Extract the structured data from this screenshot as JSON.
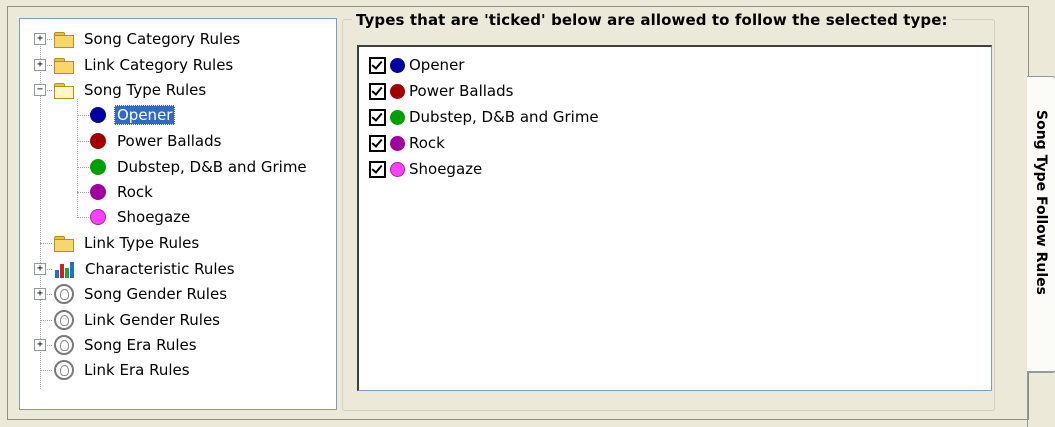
{
  "tree": {
    "items": [
      {
        "label": "Song Category Rules",
        "icon": "folder-icon"
      },
      {
        "label": "Link Category Rules",
        "icon": "folder-icon"
      },
      {
        "label": "Song Type Rules",
        "icon": "open-folder-icon"
      },
      {
        "label": "Opener",
        "icon": "dot",
        "color": "#0000a0",
        "selected": true
      },
      {
        "label": "Power Ballads",
        "icon": "dot",
        "color": "#a00000"
      },
      {
        "label": "Dubstep, D&B and Grime",
        "icon": "dot",
        "color": "#00a000"
      },
      {
        "label": "Rock",
        "icon": "dot",
        "color": "#a000a0"
      },
      {
        "label": "Shoegaze",
        "icon": "dot",
        "color": "#ff40ff"
      },
      {
        "label": "Link Type Rules",
        "icon": "folder-icon"
      },
      {
        "label": "Characteristic Rules",
        "icon": "chart-icon"
      },
      {
        "label": "Song Gender Rules",
        "icon": "gender-icon"
      },
      {
        "label": "Link Gender Rules",
        "icon": "gender-icon"
      },
      {
        "label": "Song Era Rules",
        "icon": "gender-icon"
      },
      {
        "label": "Link Era Rules",
        "icon": "gender-icon"
      }
    ]
  },
  "group": {
    "title": "Types that are 'ticked' below are allowed to follow the selected type:"
  },
  "checklist": [
    {
      "label": "Opener",
      "checked": true,
      "color": "#0000a0"
    },
    {
      "label": "Power Ballads",
      "checked": true,
      "color": "#a00000"
    },
    {
      "label": "Dubstep, D&B and Grime",
      "checked": true,
      "color": "#00a000"
    },
    {
      "label": "Rock",
      "checked": true,
      "color": "#a000a0"
    },
    {
      "label": "Shoegaze",
      "checked": true,
      "color": "#ff40ff"
    }
  ],
  "side_tab": {
    "label": "Song Type Follow Rules"
  }
}
